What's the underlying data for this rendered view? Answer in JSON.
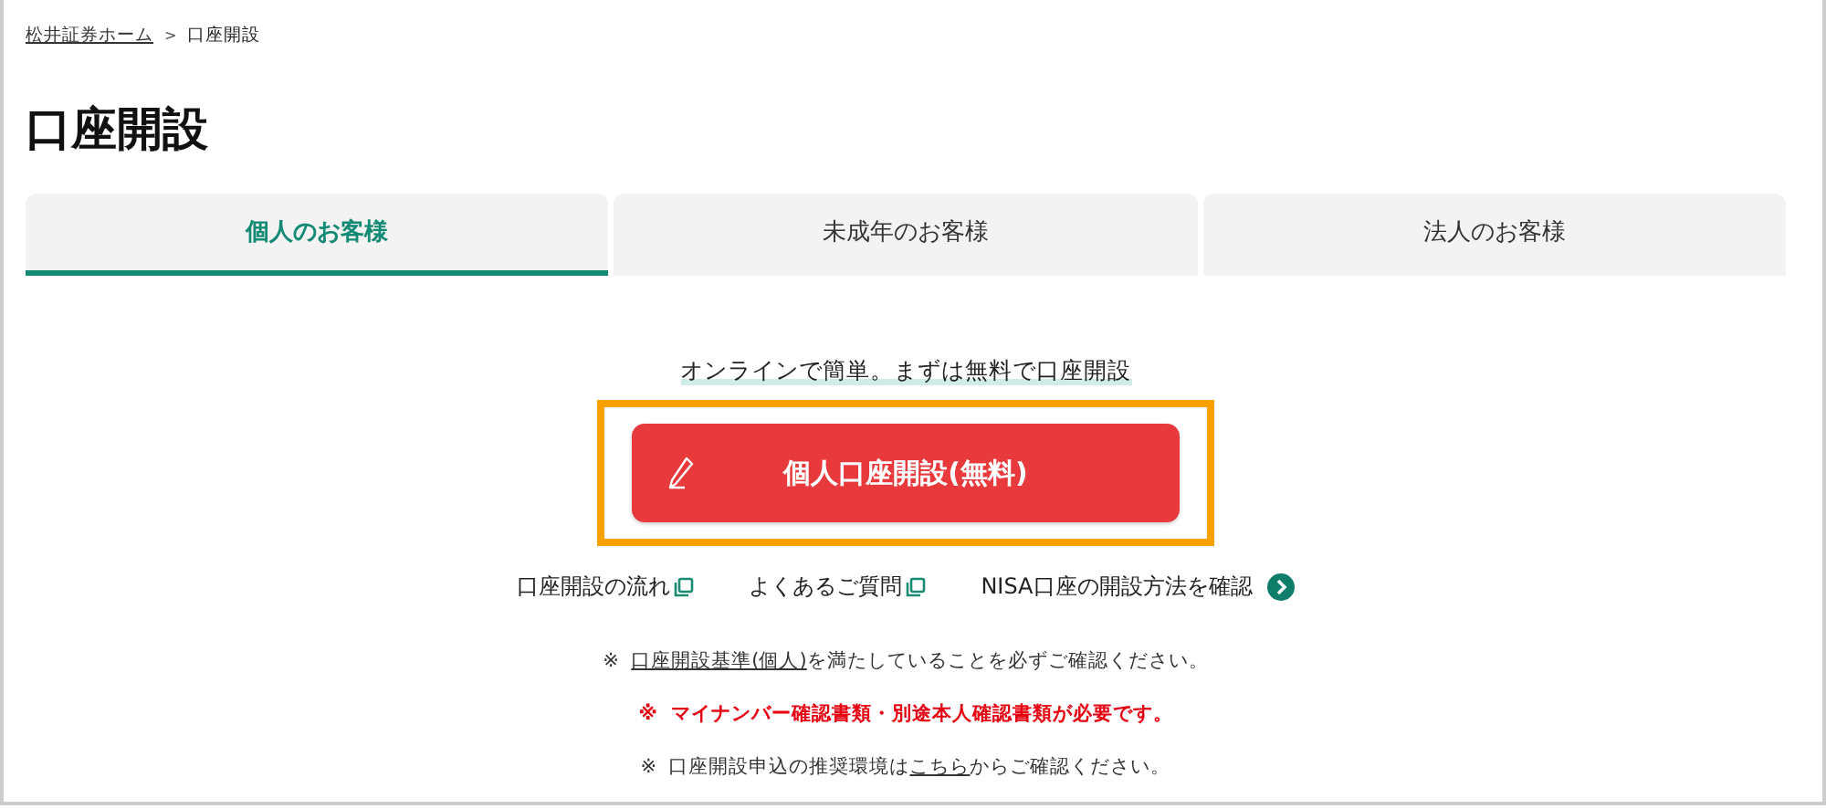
{
  "breadcrumb": {
    "separator": ">",
    "items": [
      {
        "label": "松井証券ホーム",
        "kind": "link"
      },
      {
        "label": "口座開設",
        "kind": "current"
      }
    ]
  },
  "title": "口座開設",
  "tabs": [
    {
      "label": "個人のお客様",
      "selected": true
    },
    {
      "label": "未成年のお客様",
      "selected": false
    },
    {
      "label": "法人のお客様",
      "selected": false
    }
  ],
  "tagline": "オンラインで簡単。まずは無料で口座開設",
  "cta_button": {
    "label": "個人口座開設(無料)",
    "highlighted": true
  },
  "links": [
    {
      "label": "口座開設の流れ",
      "kind": "external"
    },
    {
      "label": "よくあるご質問",
      "kind": "external"
    },
    {
      "label": "NISA口座の開設方法を確認",
      "kind": "arrow"
    }
  ],
  "notes": [
    {
      "mark": "※",
      "kind": "normal",
      "link": "口座開設基準(個人)",
      "after": "を満たしていることを必ずご確認ください。"
    },
    {
      "mark": "※",
      "kind": "warning",
      "before": "マイナンバー確認書類・別途本人確認書類が必要です。"
    },
    {
      "mark": "※",
      "kind": "normal",
      "before": "口座開設申込の推奨環境は",
      "link": "こちら",
      "after": "からご確認ください。"
    }
  ]
}
